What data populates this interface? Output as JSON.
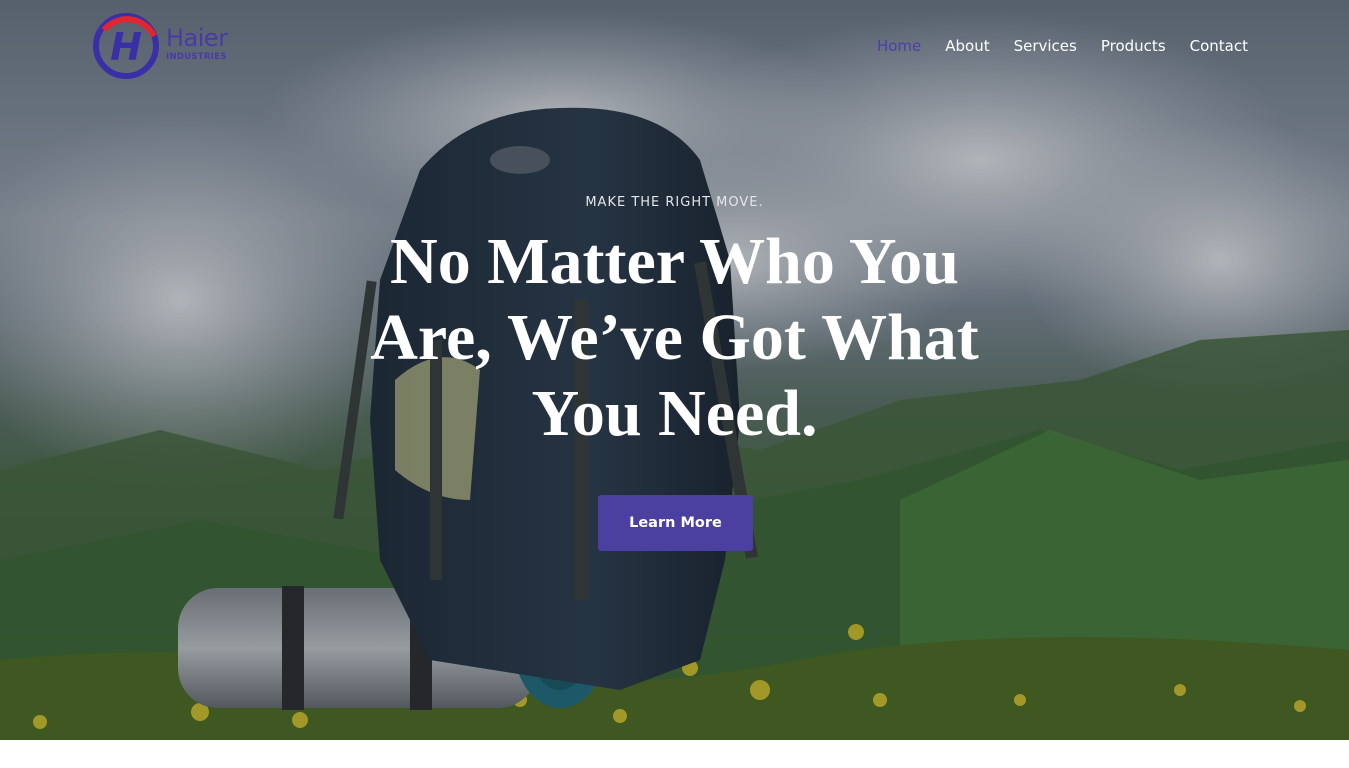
{
  "brand": {
    "name": "Haier",
    "subtitle": "INDUSTRIES",
    "logo_icon": "h-circle-logo-icon"
  },
  "nav": {
    "items": [
      {
        "label": "Home",
        "active": true
      },
      {
        "label": "About",
        "active": false
      },
      {
        "label": "Services",
        "active": false
      },
      {
        "label": "Products",
        "active": false
      },
      {
        "label": "Contact",
        "active": false
      }
    ]
  },
  "hero": {
    "tagline": "MAKE THE RIGHT MOVE.",
    "headline": "No Matter Who You Are, We’ve Got What You Need.",
    "cta_label": "Learn More",
    "background": "backpack-mountain-photo"
  },
  "colors": {
    "accent": "#4b3fa0",
    "nav_active": "#4b3fa8",
    "logo_red": "#e0262e",
    "logo_blue": "#3b2fa8"
  }
}
